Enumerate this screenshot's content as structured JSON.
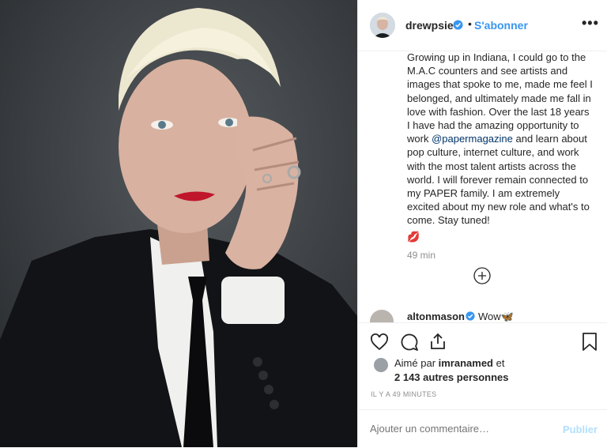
{
  "post": {
    "photo_alt": "portrait photo",
    "author": {
      "username": "drewpsie",
      "verified": true,
      "follow_label": "S'abonner",
      "separator": "•",
      "more_label": "•••"
    },
    "caption": {
      "line_a": "Growing up in Indiana, I could go to the M.A.C counters and see artists and images that spoke to me, made me feel I belonged, and ultimately made me fall in love with fashion. Over the last 18 years I have had the amazing opportunity to work ",
      "mention": "@papermagazine",
      "line_b": " and learn about pop culture, internet culture, and work with the most talent artists across the world. I will forever remain connected to my PAPER family. I am extremely excited about my new role and what's to come. Stay tuned!",
      "emoji": "💋",
      "time": "49 min"
    },
    "comment": {
      "username": "altonmason",
      "verified": true,
      "text": "Wow🦋"
    },
    "likes": {
      "prefix": "Aimé par ",
      "user": "imranamed",
      "suffix": " et",
      "others": "2 143 autres personnes"
    },
    "posted_ago": "IL Y A 49 MINUTES",
    "add_comment": {
      "placeholder": "Ajouter un commentaire…",
      "publish_label": "Publier"
    }
  },
  "colors": {
    "accent": "#3897f0",
    "text": "#262626",
    "muted": "#8e8e8e",
    "publish_disabled": "#b2dffc",
    "border": "#efefef"
  },
  "icons": [
    "heart-icon",
    "comment-icon",
    "share-icon",
    "bookmark-icon",
    "plus-circle-icon",
    "verified-icon",
    "more-icon"
  ]
}
